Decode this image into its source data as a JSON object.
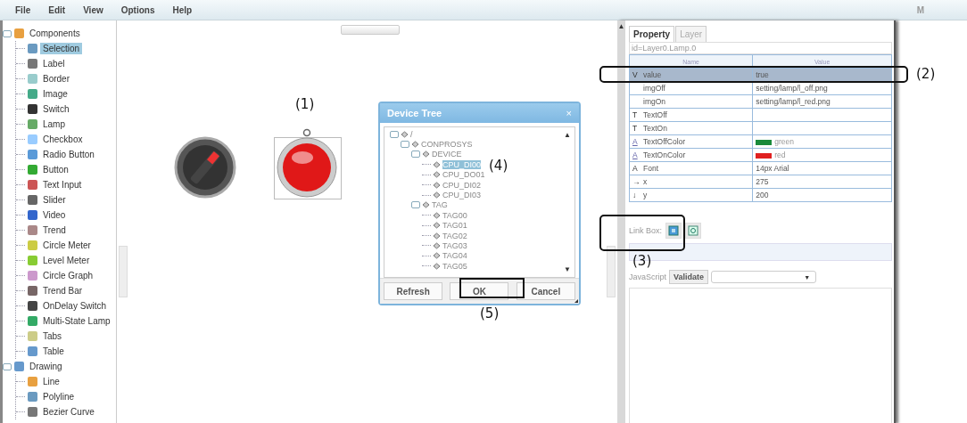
{
  "menu": [
    {
      "label": "File"
    },
    {
      "label": "Edit"
    },
    {
      "label": "View"
    },
    {
      "label": "Options"
    },
    {
      "label": "Help"
    },
    {
      "label": "M"
    }
  ],
  "sidebar": {
    "items": [
      {
        "label": "Components",
        "expanded": true,
        "selected": false,
        "children": [
          {
            "label": "Selection",
            "selected": true
          },
          {
            "label": "Label",
            "selected": false
          },
          {
            "label": "Border",
            "selected": false
          },
          {
            "label": "Image",
            "selected": false
          },
          {
            "label": "Switch",
            "selected": false
          },
          {
            "label": "Lamp",
            "selected": false
          },
          {
            "label": "Checkbox",
            "selected": false
          },
          {
            "label": "Radio Button",
            "selected": false
          },
          {
            "label": "Button",
            "selected": false
          },
          {
            "label": "Text Input",
            "selected": false
          },
          {
            "label": "Slider",
            "selected": false
          },
          {
            "label": "Video",
            "selected": false
          },
          {
            "label": "Trend",
            "selected": false
          },
          {
            "label": "Circle Meter",
            "selected": false
          },
          {
            "label": "Level Meter",
            "selected": false
          },
          {
            "label": "Circle Graph",
            "selected": false
          },
          {
            "label": "Trend Bar",
            "selected": false
          },
          {
            "label": "OnDelay Switch",
            "selected": false
          },
          {
            "label": "Multi-State Lamp",
            "selected": false
          },
          {
            "label": "Tabs",
            "selected": false
          },
          {
            "label": "Table",
            "selected": false
          }
        ]
      },
      {
        "label": "Drawing",
        "expanded": true,
        "selected": false,
        "children": [
          {
            "label": "Line",
            "selected": false
          },
          {
            "label": "Polyline",
            "selected": false
          },
          {
            "label": "Bezier Curve",
            "selected": false
          }
        ]
      }
    ]
  },
  "canvas": {
    "switch_on": true,
    "lamp_on": true,
    "lamp_selected": true
  },
  "dialog": {
    "title": "Device Tree",
    "close": "×",
    "tree": [
      {
        "label": "/",
        "selected": false,
        "children": [
          {
            "label": "CONPROSYS",
            "selected": false,
            "children": [
              {
                "label": "DEVICE",
                "selected": false,
                "children": [
                  {
                    "label": "CPU_DI00",
                    "selected": true
                  },
                  {
                    "label": "CPU_DO01",
                    "selected": false
                  },
                  {
                    "label": "CPU_DI02",
                    "selected": false
                  },
                  {
                    "label": "CPU_DI03",
                    "selected": false
                  }
                ]
              },
              {
                "label": "TAG",
                "selected": false,
                "children": [
                  {
                    "label": "TAG00",
                    "selected": false
                  },
                  {
                    "label": "TAG01",
                    "selected": false
                  },
                  {
                    "label": "TAG02",
                    "selected": false
                  },
                  {
                    "label": "TAG03",
                    "selected": false
                  },
                  {
                    "label": "TAG04",
                    "selected": false
                  },
                  {
                    "label": "TAG05",
                    "selected": false
                  }
                ]
              }
            ]
          }
        ]
      }
    ],
    "scroll_up": "▲",
    "scroll_down": "▼",
    "buttons": [
      {
        "label": "Refresh"
      },
      {
        "label": "OK"
      },
      {
        "label": "Cancel"
      }
    ]
  },
  "panel": {
    "scroll_up": "▲",
    "tabs": [
      {
        "label": "Property",
        "selected": true
      },
      {
        "label": "Layer",
        "selected": false
      }
    ],
    "id_line": "id=Layer0.Lamp.0",
    "columns": [
      "Name",
      "Value"
    ],
    "rows": [
      {
        "icon": "V",
        "name": "value",
        "value": "true",
        "selected": true
      },
      {
        "icon": "",
        "name": "imgOff",
        "value": "setting/lamp/l_off.png",
        "selected": false
      },
      {
        "icon": "",
        "name": "imgOn",
        "value": "setting/lamp/l_red.png",
        "selected": false
      },
      {
        "icon": "T",
        "name": "TextOff",
        "value": "",
        "selected": false
      },
      {
        "icon": "T",
        "name": "TextOn",
        "value": "",
        "selected": false
      },
      {
        "icon": "A",
        "name": "TextOffColor",
        "value": "green",
        "color": "#1a8a3a",
        "selected": false
      },
      {
        "icon": "A",
        "name": "TextOnColor",
        "value": "red",
        "color": "#e02020",
        "selected": false
      },
      {
        "icon": "A",
        "name": "Font",
        "value": "14px Arial",
        "selected": false
      },
      {
        "icon": "→",
        "name": "x",
        "value": "275",
        "selected": false
      },
      {
        "icon": "↓",
        "name": "y",
        "value": "200",
        "selected": false
      }
    ],
    "link_box_label": "Link Box:",
    "script_label": "JavaScript",
    "validate": "Validate",
    "select_arrow": "▼"
  },
  "annotations": [
    {
      "label": "(1)"
    },
    {
      "label": "(2)"
    },
    {
      "label": "(3)"
    },
    {
      "label": "(4)"
    },
    {
      "label": "(5)"
    }
  ]
}
